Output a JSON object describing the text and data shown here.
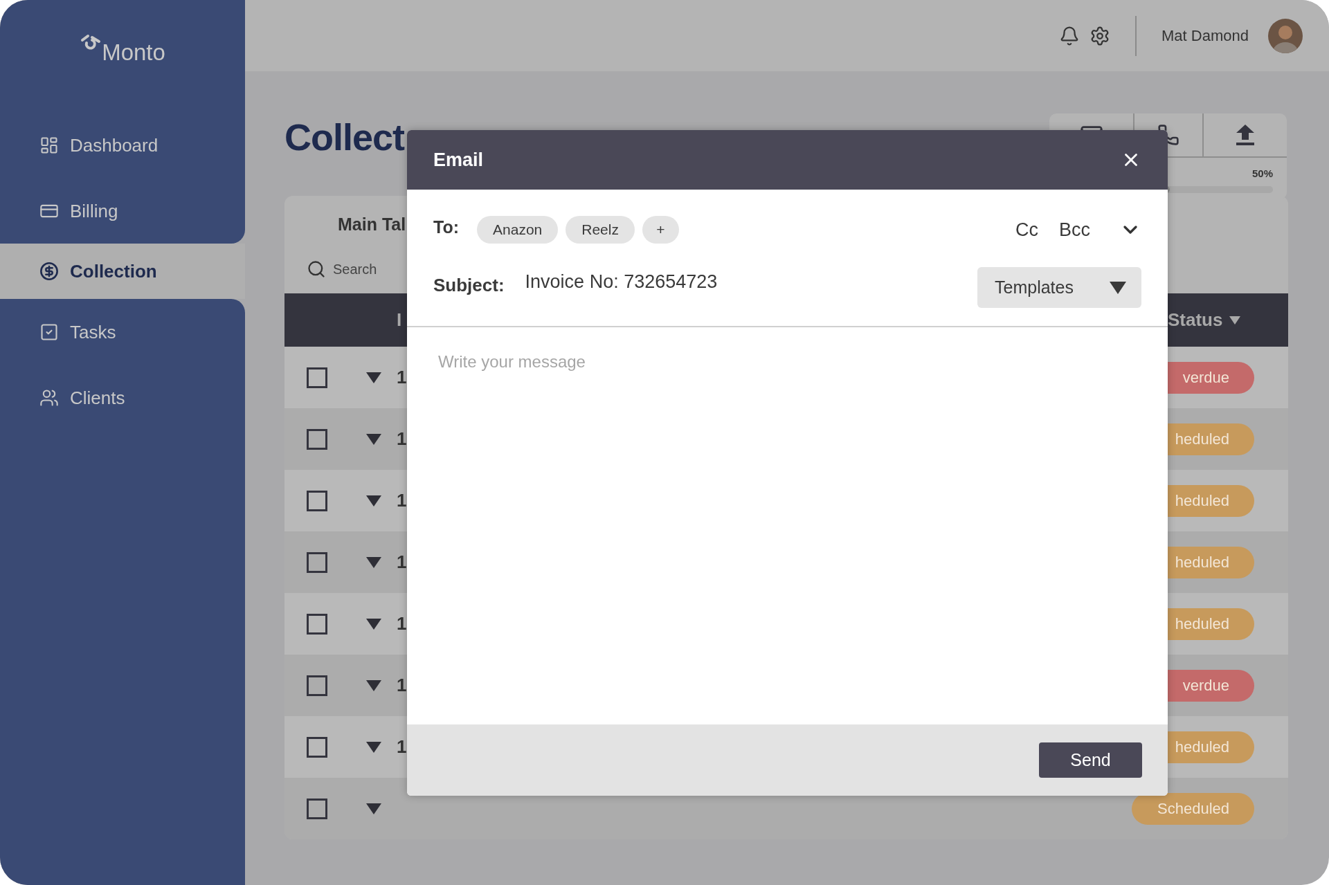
{
  "sidebar": {
    "logo": "Monto",
    "items": [
      {
        "label": "Dashboard",
        "selected": false
      },
      {
        "label": "Billing",
        "selected": false
      },
      {
        "label": "Collection",
        "selected": true
      },
      {
        "label": "Tasks",
        "selected": false
      },
      {
        "label": "Clients",
        "selected": false
      }
    ]
  },
  "top_bar": {
    "user_name": "Mat Damond"
  },
  "page_title": "Collect",
  "actions": {
    "progress": {
      "reading": "50%",
      "level": 0.5
    }
  },
  "table": {
    "title": "Main Tal",
    "search_placeholder": "Search",
    "columns": [
      "I",
      "Status"
    ],
    "rows": [
      {
        "id": "1",
        "checked": false,
        "status": "verdue",
        "color": "#c46a6a"
      },
      {
        "id": "1",
        "checked": false,
        "status": "heduled",
        "color": "#c79a5c"
      },
      {
        "id": "1",
        "checked": false,
        "status": "heduled",
        "color": "#c79a5c"
      },
      {
        "id": "1",
        "checked": false,
        "status": "heduled",
        "color": "#c79a5c"
      },
      {
        "id": "1",
        "checked": false,
        "status": "heduled",
        "color": "#c79a5c"
      },
      {
        "id": "1",
        "checked": false,
        "status": "verdue",
        "color": "#c46a6a"
      },
      {
        "id": "1",
        "checked": false,
        "status": "heduled",
        "color": "#c79a5c"
      },
      {
        "checked": false,
        "status": "Scheduled",
        "color": "#c79a5c"
      }
    ]
  },
  "email_dialog": {
    "title": "Email",
    "to_label": "To:",
    "recipients": [
      "Anazon",
      "Reelz"
    ],
    "add_recipient": "+",
    "cc": "Cc",
    "bcc": "Bcc",
    "subject_label": "Subject:",
    "subject": "Invoice No: 732654723",
    "templates": "Templates",
    "message_placeholder": "Write your message",
    "send": "Send"
  }
}
